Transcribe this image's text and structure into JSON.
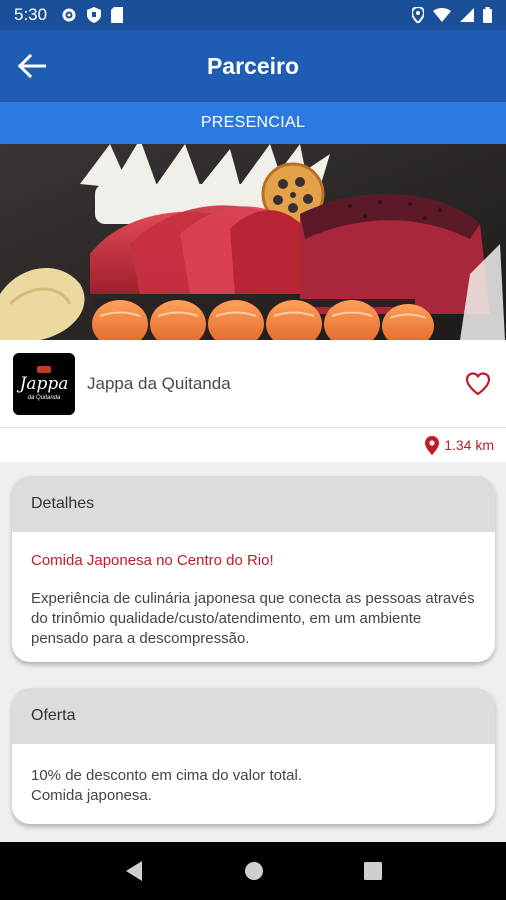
{
  "status_bar": {
    "time": "5:30",
    "left_icons": [
      "gear-icon",
      "shield-icon",
      "sim-card-icon"
    ],
    "right_icons": [
      "location-icon",
      "wifi-icon",
      "signal-icon",
      "battery-icon"
    ]
  },
  "app_bar": {
    "title": "Parceiro",
    "back_icon": "arrow-back-icon"
  },
  "mode": {
    "label": "PRESENCIAL"
  },
  "partner": {
    "logo_text": "Jappa",
    "logo_subtext": "da Quitanda",
    "name": "Jappa da Quitanda",
    "favorite_icon": "heart-outline-icon",
    "distance": "1.34 km",
    "distance_icon": "map-pin-icon"
  },
  "details": {
    "header": "Detalhes",
    "subtitle": "Comida Japonesa no Centro do Rio!",
    "description": "Experiência de culinária japonesa que conecta as pessoas através do trinômio qualidade/custo/atendimento, em um ambiente pensado para a descompressão."
  },
  "offer": {
    "header": "Oferta",
    "line1": "10% de desconto em cima do valor total.",
    "line2": "Comida japonesa."
  },
  "colors": {
    "status_bar": "#1a4f9a",
    "app_bar": "#1e5db3",
    "mode_bar": "#2b7ae4",
    "accent_red": "#c11b2a",
    "card_header": "#dcdcdc"
  }
}
